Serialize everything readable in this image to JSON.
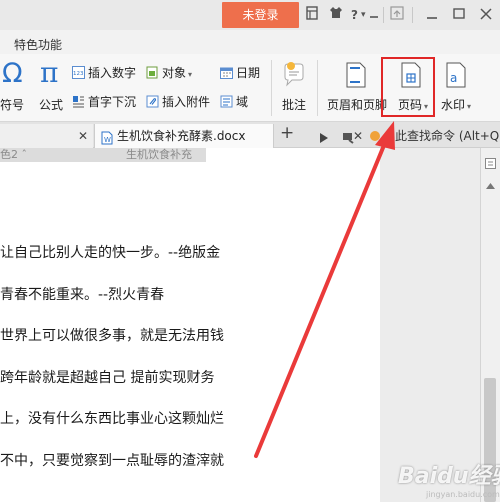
{
  "titlebar": {
    "login_label": "未登录",
    "help_label": "?",
    "dropdown_arrow": "▾"
  },
  "menubar": {
    "special_features": "特色功能"
  },
  "ribbon": {
    "symbol_label": "符号",
    "formula_label": "公式",
    "insert_number": "插入数字",
    "object": "对象",
    "dropcap": "首字下沉",
    "insert_attachment": "插入附件",
    "date": "日期",
    "field": "域",
    "annotation": "批注",
    "header_footer": "页眉和页脚",
    "page_number": "页码",
    "watermark": "水印",
    "icons": [
      "omega-icon",
      "pi-icon",
      "insert-number-icon",
      "object-icon",
      "dropcap-icon",
      "attachment-icon",
      "date-icon",
      "field-icon",
      "annotation-icon",
      "header-footer-icon",
      "page-number-icon",
      "watermark-icon"
    ]
  },
  "tabs": {
    "doc_tab": "生机饮食补充酵素.docx",
    "new_tab": "+",
    "search_command": "点此查找命令 (Alt+Q)",
    "ghost_left": "色2 ˆ",
    "ghost_right": "生机饮食补充"
  },
  "document": {
    "lines": [
      "让自己比别人走的快一步。--绝版金",
      "青春不能重来。--烈火青春",
      "世界上可以做很多事，就是无法用钱",
      "跨年龄就是超越自己 提前实现财务",
      "上，没有什么东西比事业心这颗灿烂",
      "不中，只要觉察到一点耻辱的渣滓就"
    ]
  },
  "watermark": {
    "brand": "Baidu经验",
    "url": "jingyan.baidu.com"
  },
  "colors": {
    "accent": "#ee6f4c",
    "highlight": "#e02727",
    "arrow": "#ea3a3a"
  }
}
